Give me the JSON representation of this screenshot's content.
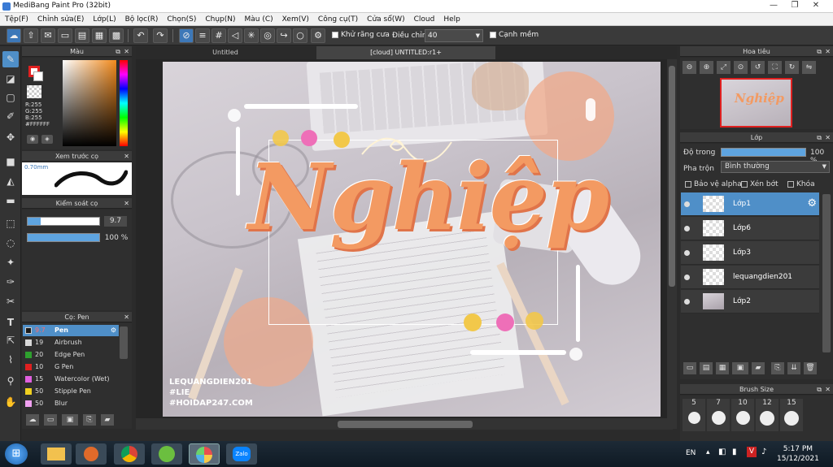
{
  "window": {
    "title": "MediBang Paint Pro (32bit)"
  },
  "menu": [
    "Tệp(F)",
    "Chỉnh sửa(E)",
    "Lớp(L)",
    "Bộ lọc(R)",
    "Chọn(S)",
    "Chụp(N)",
    "Màu (C)",
    "Xem(V)",
    "Công cụ(T)",
    "Cửa sổ(W)",
    "Cloud",
    "Help"
  ],
  "toolbar": {
    "antialias_label": "Khử răng cưa",
    "correction_label": "Điều chỉnh",
    "correction_value": "40",
    "snap_label": "Cạnh mềm"
  },
  "color_panel": {
    "title": "Màu",
    "rgb": [
      "R:255",
      "G:255",
      "B:255"
    ],
    "hex": "#FFFFFF",
    "fg_color": "#e02020",
    "bg_color": "#ffffff"
  },
  "brush_preview": {
    "title": "Xem trước cọ",
    "size": "0.70mm"
  },
  "brush_control": {
    "title": "Kiểm soát cọ",
    "size_value": "9.7",
    "opacity_value": "100 %"
  },
  "brush_list": {
    "title": "Cọ: Pen",
    "items": [
      {
        "size": "9.7",
        "name": "Pen",
        "color": "#1a1a1a",
        "selected": true
      },
      {
        "size": "19",
        "name": "Airbrush",
        "color": "#d8d8d8"
      },
      {
        "size": "20",
        "name": "Edge Pen",
        "color": "#2ea02e"
      },
      {
        "size": "10",
        "name": "G Pen",
        "color": "#e02020"
      },
      {
        "size": "15",
        "name": "Watercolor (Wet)",
        "color": "#e060e0"
      },
      {
        "size": "50",
        "name": "Stipple Pen",
        "color": "#f0d020"
      },
      {
        "size": "50",
        "name": "Blur",
        "color": "#f0a0f0"
      }
    ]
  },
  "tabs": [
    "Untitled",
    "[cloud] UNTITLED:r1+"
  ],
  "artwork": {
    "main_text": "Nghiệp",
    "watermark": [
      "LEQUANGDIEN201",
      "#LIE",
      "#HOIDAP247.COM"
    ]
  },
  "navigator": {
    "title": "Hoa tiêu"
  },
  "layer_panel": {
    "title": "Lớp",
    "opacity_label": "Độ trong",
    "opacity_value": "100 %",
    "opacity_fraction": 1.0,
    "blend_label": "Pha trộn",
    "blend_value": "Bình thường",
    "protect_alpha": "Bảo vệ alpha",
    "clipping": "Xén bớt",
    "lock": "Khóa",
    "layers": [
      {
        "name": "Lớp1",
        "selected": true
      },
      {
        "name": "Lớp6"
      },
      {
        "name": "Lớp3"
      },
      {
        "name": "lequangdien201"
      },
      {
        "name": "Lớp2"
      }
    ]
  },
  "brush_size_panel": {
    "title": "Brush Size",
    "sizes": [
      "5",
      "7",
      "10",
      "12",
      "15"
    ]
  },
  "taskbar": {
    "lang": "EN",
    "time": "5:17 PM",
    "date": "15/12/2021"
  }
}
